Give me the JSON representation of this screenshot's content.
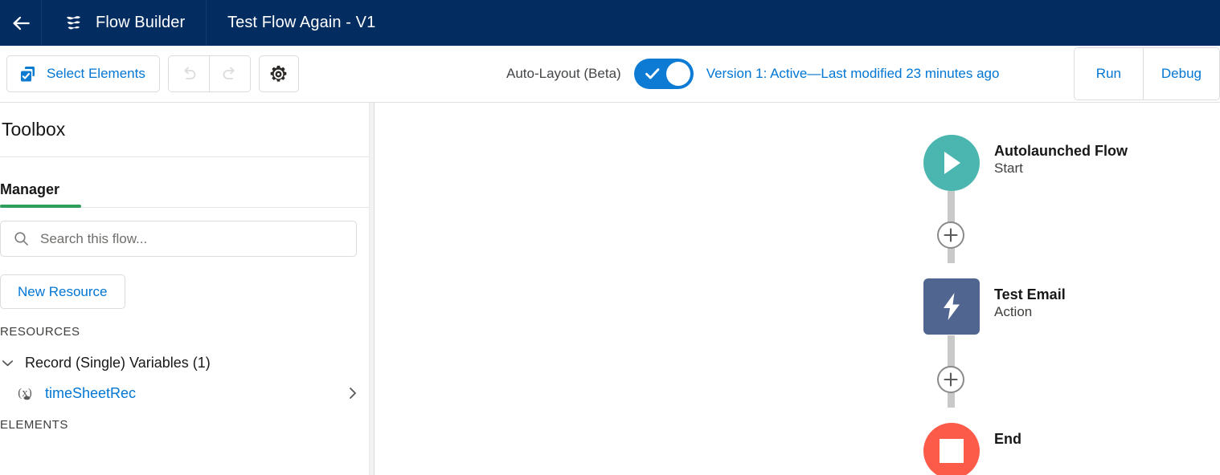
{
  "header": {
    "back_icon": "back-arrow-icon",
    "app_icon": "flow-builder-logo-icon",
    "app_title": "Flow Builder",
    "flow_title": "Test Flow Again - V1"
  },
  "toolbar": {
    "select_elements_label": "Select Elements",
    "select_elements_icon": "select-elements-icon",
    "undo_icon": "undo-icon",
    "redo_icon": "redo-icon",
    "settings_icon": "gear-icon",
    "auto_layout_label": "Auto-Layout (Beta)",
    "auto_layout_on": true,
    "version_status": "Version 1: Active—Last modified 23 minutes ago",
    "run_label": "Run",
    "debug_label": "Debug",
    "accent_blue": "#0176d3",
    "toggle_on_color": "#0d7bd4"
  },
  "toolbox": {
    "title": "Toolbox",
    "tabs": [
      {
        "label": "Manager",
        "active": true
      }
    ],
    "active_tab_color": "#2e9e5b",
    "search": {
      "placeholder": "Search this flow...",
      "value": "",
      "icon": "search-icon"
    },
    "new_resource_label": "New Resource",
    "resources_label": "RESOURCES",
    "resource_groups": [
      {
        "label": "Record (Single) Variables (1)",
        "expanded": true,
        "items": [
          {
            "name": "timeSheetRec",
            "icon": "variable-icon"
          }
        ]
      }
    ],
    "elements_label": "ELEMENTS"
  },
  "canvas": {
    "nodes": [
      {
        "title": "Autolaunched Flow",
        "subtitle": "Start",
        "shape": "circle",
        "icon": "play-icon",
        "color": "#4bb6b0"
      },
      {
        "title": "Test Email",
        "subtitle": "Action",
        "shape": "rounded-square",
        "icon": "lightning-bolt-icon",
        "color": "#50658f"
      },
      {
        "title": "End",
        "subtitle": "",
        "shape": "circle",
        "icon": "stop-square-icon",
        "color": "#fc5b4a"
      }
    ],
    "add_buttons": [
      {
        "label": "+",
        "icon": "plus-icon"
      },
      {
        "label": "+",
        "icon": "plus-icon"
      }
    ],
    "connector_color": "#c9c9c9"
  }
}
